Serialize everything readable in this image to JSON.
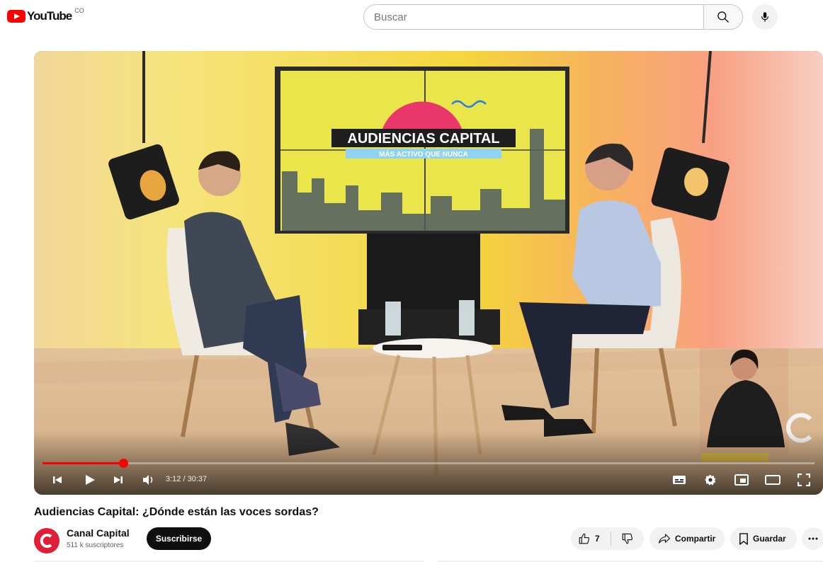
{
  "header": {
    "logo_text": "YouTube",
    "country_code": "CO",
    "search_placeholder": "Buscar"
  },
  "player": {
    "set_title": "AUDIENCIAS CAPITAL",
    "set_subtitle": "MÁS ACTIVO QUE NUNCA",
    "time": "3:12 / 30:37",
    "progress_fraction": 0.105,
    "accent": "#ff0000"
  },
  "video": {
    "title": "Audiencias Capital: ¿Dónde están las voces sordas?"
  },
  "channel": {
    "name": "Canal Capital",
    "subscribers": "511 k suscriptores",
    "avatar_color": "#e01e37"
  },
  "actions": {
    "subscribe_label": "Suscribirse",
    "like_count": "7",
    "share_label": "Compartir",
    "save_label": "Guardar"
  }
}
